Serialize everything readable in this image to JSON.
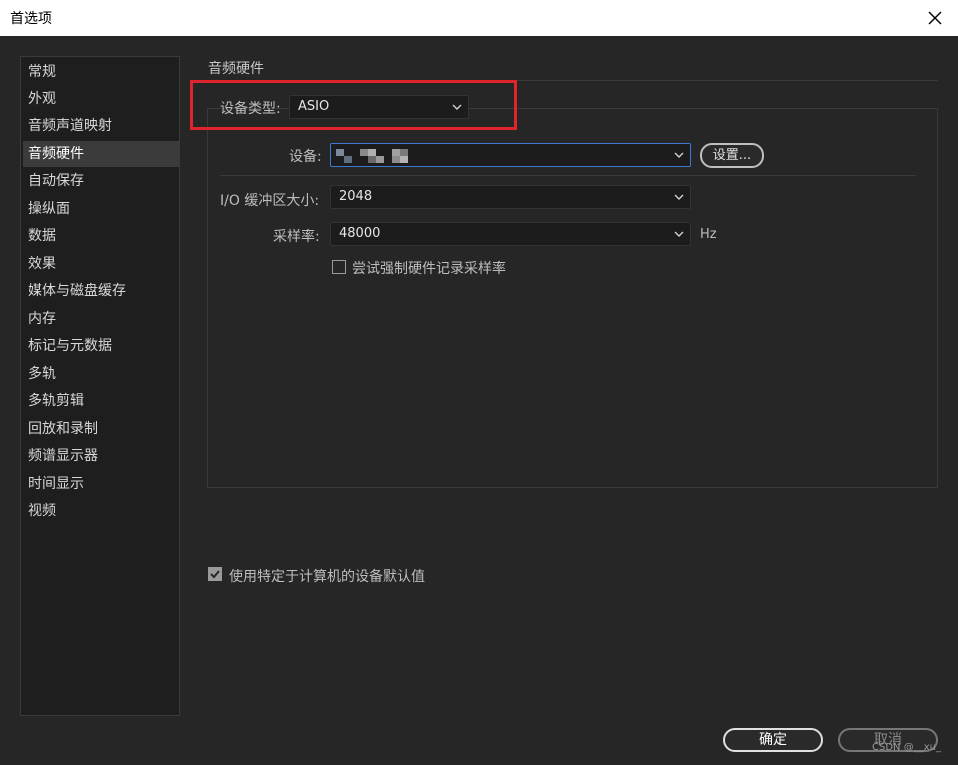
{
  "window": {
    "title": "首选项"
  },
  "sidebar": {
    "items": [
      {
        "label": "常规"
      },
      {
        "label": "外观"
      },
      {
        "label": "音频声道映射"
      },
      {
        "label": "音频硬件"
      },
      {
        "label": "自动保存"
      },
      {
        "label": "操纵面"
      },
      {
        "label": "数据"
      },
      {
        "label": "效果"
      },
      {
        "label": "媒体与磁盘缓存"
      },
      {
        "label": "内存"
      },
      {
        "label": "标记与元数据"
      },
      {
        "label": "多轨"
      },
      {
        "label": "多轨剪辑"
      },
      {
        "label": "回放和录制"
      },
      {
        "label": "频谱显示器"
      },
      {
        "label": "时间显示"
      },
      {
        "label": "视频"
      }
    ],
    "selected": "音频硬件"
  },
  "main": {
    "section_title": "音频硬件",
    "device_type": {
      "label": "设备类型:",
      "value": "ASIO"
    },
    "device": {
      "label": "设备:",
      "value": "",
      "settings_button": "设置..."
    },
    "buffer": {
      "label": "I/O 缓冲区大小:",
      "value": "2048"
    },
    "sample_rate": {
      "label": "采样率:",
      "value": "48000",
      "unit": "Hz"
    },
    "force_rate": {
      "label": "尝试强制硬件记录采样率",
      "checked": false
    },
    "use_defaults": {
      "label": "使用特定于计算机的设备默认值",
      "checked": true
    }
  },
  "footer": {
    "ok_label": "确定",
    "cancel_label": "取消"
  },
  "watermark": "CSDN @__xu_",
  "colors": {
    "background": "#262626",
    "sidebar_bg": "#1e1e1e",
    "selected_item": "#3b3b3b",
    "focus_border": "#3d7ad6",
    "highlight_box": "#e0242b"
  }
}
